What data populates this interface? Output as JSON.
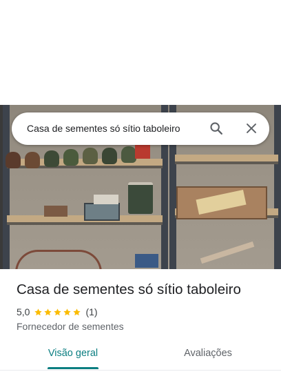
{
  "search": {
    "query": "Casa de sementes só sítio taboleiro"
  },
  "icons": {
    "search": "search-icon",
    "close": "close-icon",
    "star": "star-icon"
  },
  "place": {
    "title": "Casa de sementes só sítio taboleiro",
    "rating": "5,0",
    "stars_filled": 5,
    "review_count": "(1)",
    "category": "Fornecedor de sementes"
  },
  "tabs": [
    {
      "label": "Visão geral",
      "selected": true
    },
    {
      "label": "Avaliações",
      "selected": false
    }
  ],
  "colors": {
    "accent": "#0b7e81",
    "star": "#fbbc04"
  }
}
